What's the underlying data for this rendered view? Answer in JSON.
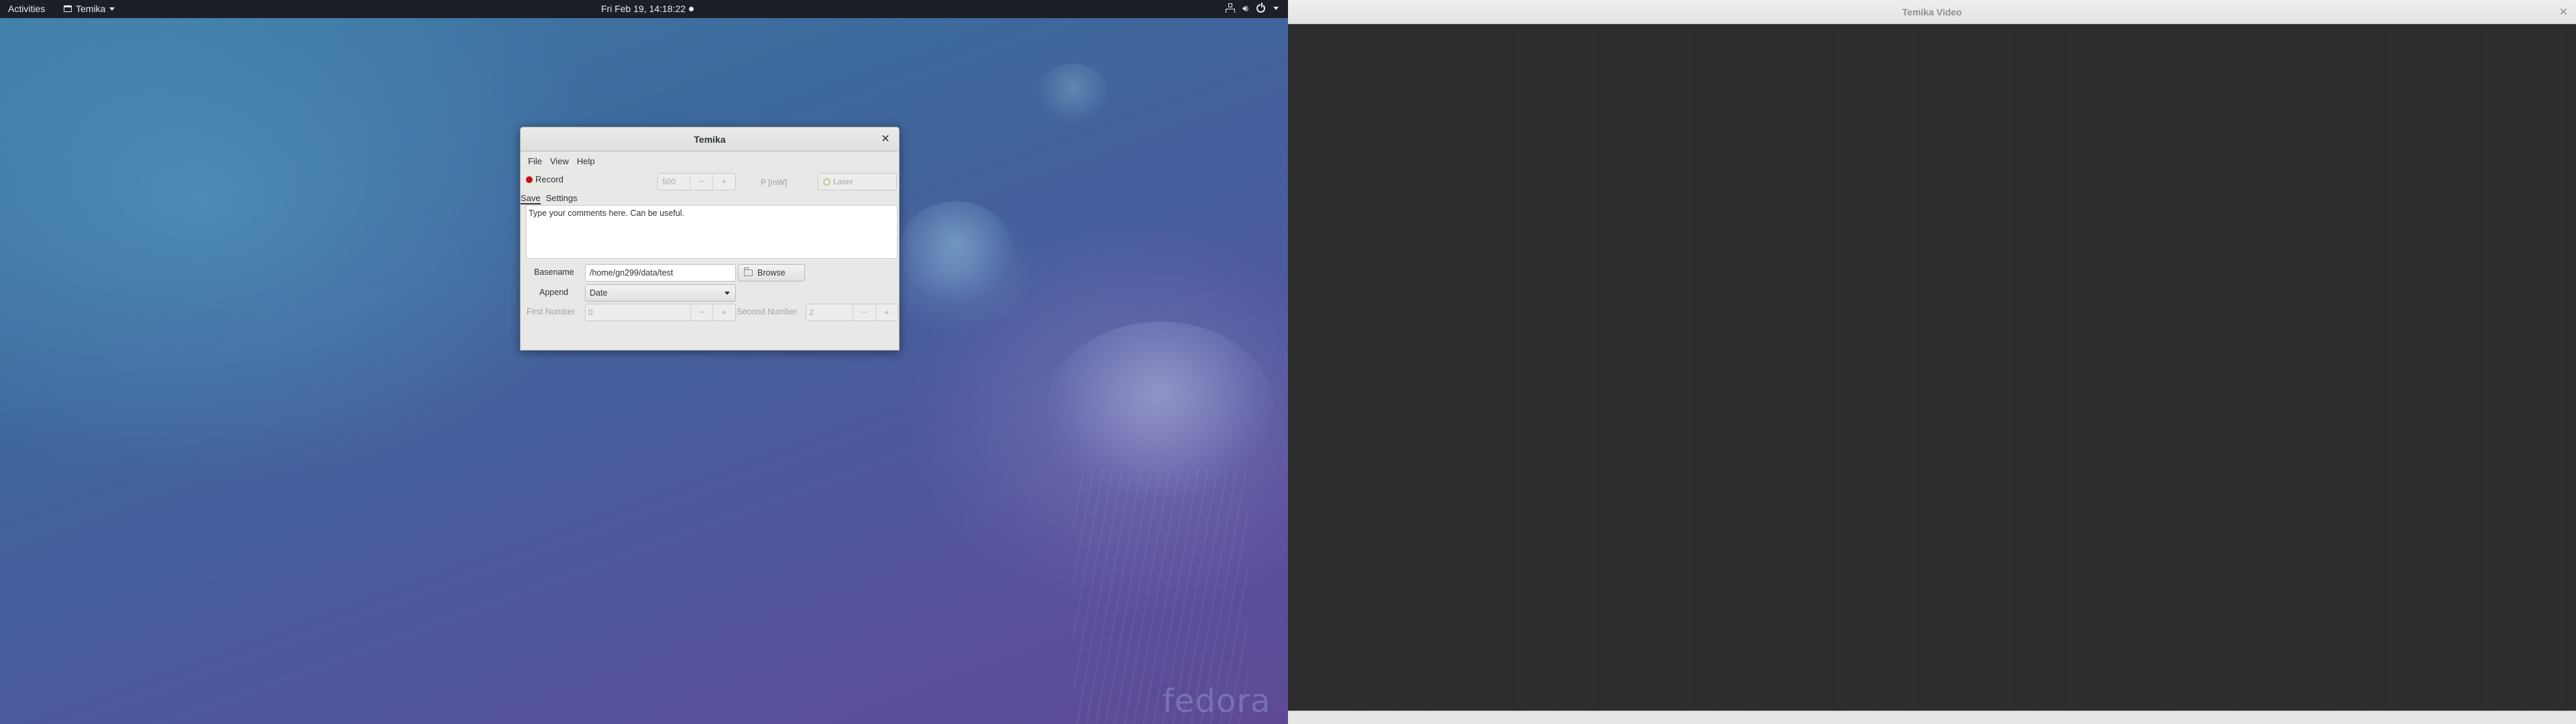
{
  "topbar": {
    "activities": "Activities",
    "app_name": "Temika",
    "clock": "Fri Feb 19, 14:18:22"
  },
  "wallpaper": {
    "brand": "fedora"
  },
  "dialog": {
    "title": "Temika",
    "menu": [
      "File",
      "View",
      "Help"
    ],
    "record_label": "Record",
    "record_color": "#cc1010",
    "exposure_value": "500",
    "minus": "−",
    "plus": "+",
    "power_label": "P [mW]",
    "laser_label": "Laser",
    "tabs": [
      "Save",
      "Settings"
    ],
    "comments_text": "Type your comments here. Can be useful.",
    "basename_label": "Basename",
    "basename_value": "/home/gn299/data/test",
    "browse_label": "Browse",
    "append_label": "Append",
    "append_value": "Date",
    "first_number_label": "First Number",
    "first_number_value": "0",
    "second_number_label": "Second Number",
    "second_number_value": "2"
  },
  "video_window": {
    "title": "Temika Video"
  }
}
